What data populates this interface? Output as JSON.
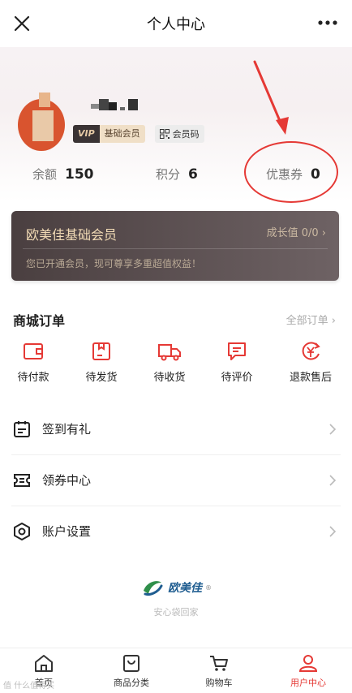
{
  "header": {
    "title": "个人中心",
    "close_icon": "close-icon",
    "more_icon": "more-dots-icon"
  },
  "profile": {
    "vip_label": "VIP",
    "member_level": "基础会员",
    "member_code_label": "会员码"
  },
  "stats": {
    "balance_label": "余额",
    "balance_value": "150",
    "points_label": "积分",
    "points_value": "6",
    "coupons_label": "优惠券",
    "coupons_value": "0"
  },
  "member_card": {
    "title": "欧美佳基础会员",
    "growth": "成长值 0/0 ›",
    "description": "您已开通会员，现可尊享多重超值权益！"
  },
  "orders": {
    "title": "商城订单",
    "all_label": "全部订单 ›",
    "items": [
      {
        "label": "待付款",
        "icon": "wallet-icon"
      },
      {
        "label": "待发货",
        "icon": "box-icon"
      },
      {
        "label": "待收货",
        "icon": "truck-icon"
      },
      {
        "label": "待评价",
        "icon": "comment-icon"
      },
      {
        "label": "退款售后",
        "icon": "refund-icon"
      }
    ]
  },
  "menu": [
    {
      "label": "签到有礼",
      "icon": "calendar-icon"
    },
    {
      "label": "领券中心",
      "icon": "ticket-icon"
    },
    {
      "label": "账户设置",
      "icon": "settings-icon"
    }
  ],
  "brand": {
    "name": "欧美佳",
    "registered": "®",
    "tagline": "安心袋回家"
  },
  "tabbar": [
    {
      "label": "首页",
      "icon": "home-icon"
    },
    {
      "label": "商品分类",
      "icon": "category-icon"
    },
    {
      "label": "购物车",
      "icon": "cart-icon"
    },
    {
      "label": "用户中心",
      "icon": "user-icon"
    }
  ],
  "watermark": "值 什么值得买",
  "colors": {
    "accent": "#e53935",
    "card_gold": "#f3dcb6",
    "annotation_red": "#e53935"
  }
}
